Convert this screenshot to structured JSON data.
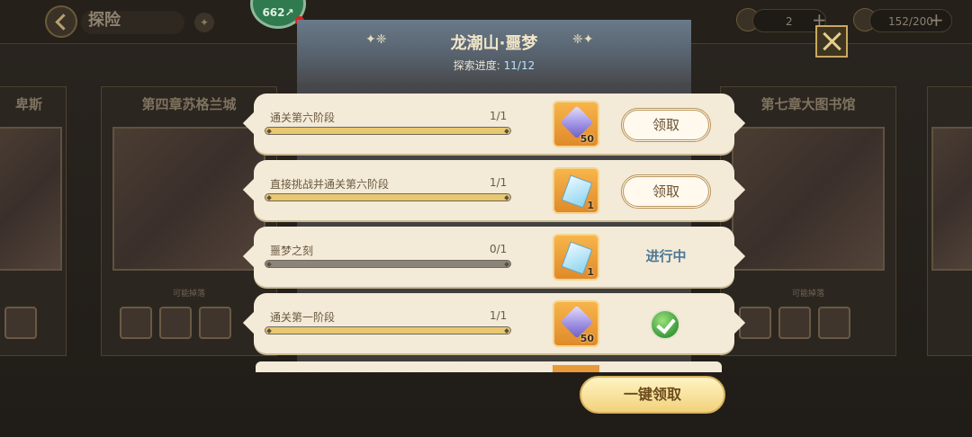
{
  "topbar": {
    "title": "探险",
    "badge_value": "662↗",
    "resources": [
      {
        "value": "2"
      },
      {
        "value": "152/200"
      }
    ]
  },
  "chapters": [
    {
      "title": "卑斯",
      "drops_label": ""
    },
    {
      "title": "第四章苏格兰城",
      "drops_label": "可能掉落"
    },
    {
      "title": "第七章大图书馆",
      "drops_label": "可能掉落"
    }
  ],
  "modal": {
    "title": "龙潮山·噩梦",
    "progress_label": "探索进度:",
    "progress_value": "11/12",
    "claim_all_label": "一键领取"
  },
  "tasks": [
    {
      "name": "通关第六阶段",
      "count": "1/1",
      "progress": 1.0,
      "reward_icon": "gem-icon",
      "reward_count": "50",
      "state": "claim",
      "action_label": "领取"
    },
    {
      "name": "直接挑战并通关第六阶段",
      "count": "1/1",
      "progress": 1.0,
      "reward_icon": "ticket-icon",
      "reward_count": "1",
      "state": "claim",
      "action_label": "领取"
    },
    {
      "name": "噩梦之刻",
      "count": "0/1",
      "progress": 0.0,
      "reward_icon": "ticket-icon",
      "reward_count": "1",
      "state": "in_progress",
      "action_label": "进行中"
    },
    {
      "name": "通关第一阶段",
      "count": "1/1",
      "progress": 1.0,
      "reward_icon": "gem-icon",
      "reward_count": "50",
      "state": "done",
      "action_label": ""
    }
  ],
  "colors": {
    "accent": "#e8c870",
    "status_text": "#4e7895",
    "check": "#3d9a3a"
  }
}
